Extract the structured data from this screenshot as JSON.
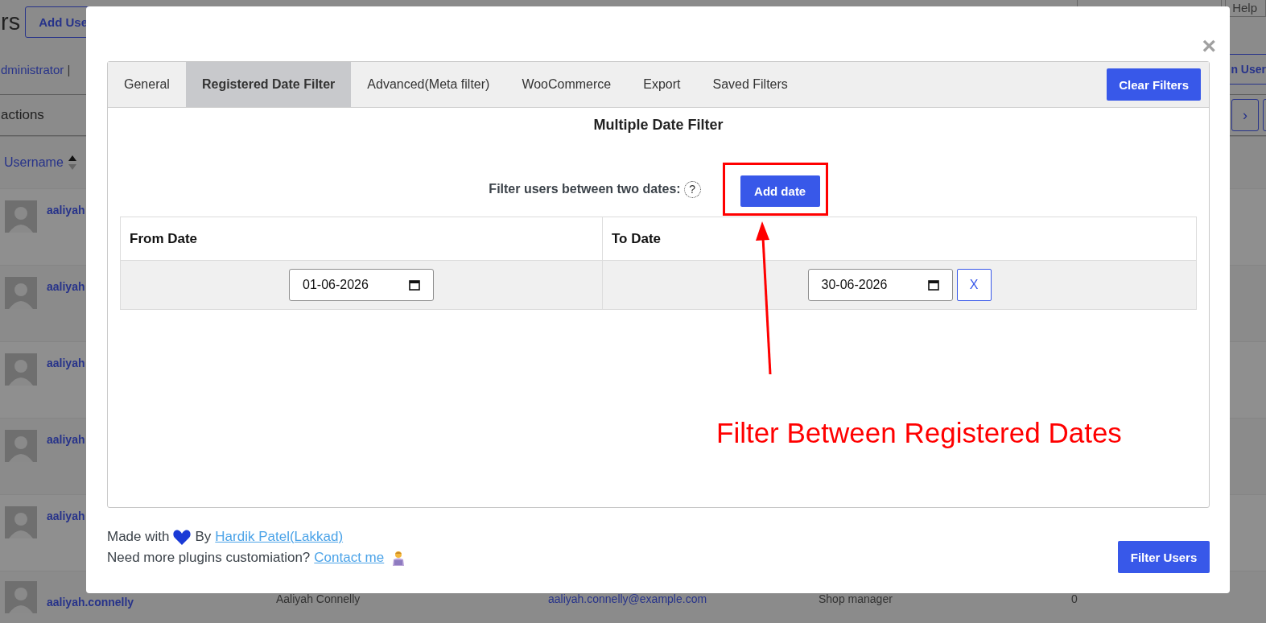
{
  "background": {
    "page_title": "rs",
    "add_button": "Add Use",
    "help": "Help",
    "role_link": "dministrator",
    "separator": "|",
    "bulk_actions": "actions",
    "right_button": "n User",
    "pagination_glyph": "›",
    "username_column": "Username",
    "rows": [
      {
        "username": "aaliyah"
      },
      {
        "username": "aaliyah"
      },
      {
        "username": "aaliyah"
      },
      {
        "username": "aaliyah"
      },
      {
        "username": "aaliyah"
      }
    ],
    "last_row": {
      "username": "aaliyah.connelly",
      "name": "Aaliyah Connelly",
      "email": "aaliyah.connelly@example.com",
      "role": "Shop manager",
      "posts": "0"
    }
  },
  "modal": {
    "close": "×",
    "tabs": [
      {
        "label": "General",
        "selected": false
      },
      {
        "label": "Registered Date Filter",
        "selected": true
      },
      {
        "label": "Advanced(Meta filter)",
        "selected": false
      },
      {
        "label": "WooCommerce",
        "selected": false
      },
      {
        "label": "Export",
        "selected": false
      },
      {
        "label": "Saved Filters",
        "selected": false
      }
    ],
    "clear_button": "Clear Filters",
    "section_title": "Multiple Date Filter",
    "filter_label": "Filter users between two dates:",
    "help_glyph": "?",
    "add_button": "Add date",
    "table": {
      "columns": [
        "From Date",
        "To Date"
      ],
      "rows": [
        {
          "from": "01-06-2026",
          "to": "30-06-2026",
          "remove": "X"
        }
      ]
    },
    "footer": {
      "made_with": "Made with",
      "by": "By",
      "author_link": "Hardik Patel(Lakkad)",
      "question": "Need more plugins customiation?",
      "contact_link": "Contact me"
    },
    "filter_button": "Filter Users"
  },
  "annotation": {
    "text": "Filter Between Registered Dates"
  }
}
